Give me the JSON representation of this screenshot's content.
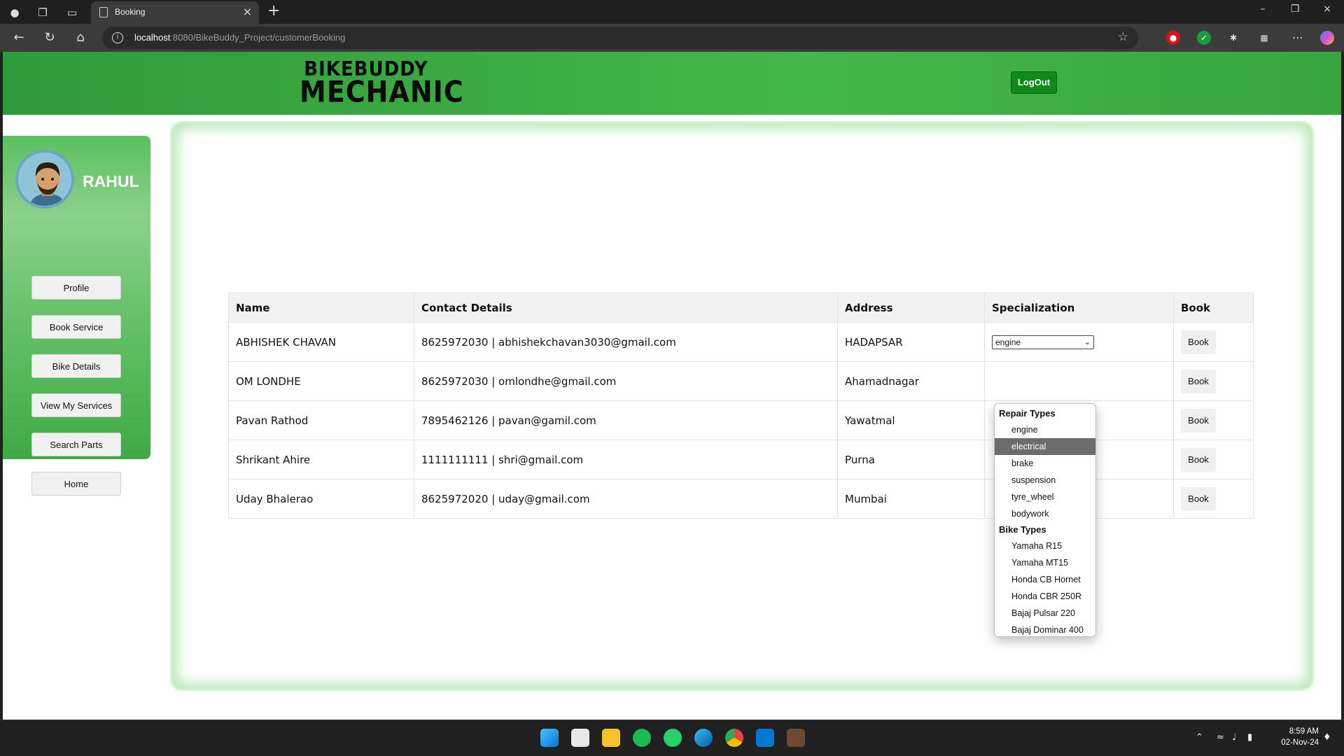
{
  "browser": {
    "tab_title": "Booking",
    "url_host": "localhost",
    "url_rest": ":8080/BikeBuddy_Project/customerBooking"
  },
  "header": {
    "logo_line1": "BIKEBUDDY",
    "logo_line2": "MECHANIC",
    "logout_label": "LogOut"
  },
  "sidebar": {
    "user_name": "RAHUL",
    "items": [
      {
        "label": "Profile"
      },
      {
        "label": "Book Service"
      },
      {
        "label": "Bike Details"
      },
      {
        "label": "View My Services"
      },
      {
        "label": "Search Parts"
      },
      {
        "label": "Home"
      }
    ]
  },
  "table": {
    "headers": [
      "Name",
      "Contact Details",
      "Address",
      "Specialization",
      "Book"
    ],
    "rows": [
      {
        "name": "ABHISHEK CHAVAN",
        "contact": "8625972030 | abhishekchavan3030@gmail.com",
        "address": "HADAPSAR",
        "specialization": "engine",
        "book": "Book"
      },
      {
        "name": "OM LONDHE",
        "contact": "8625972030 | omlondhe@gmail.com",
        "address": "Ahamadnagar",
        "specialization": "",
        "book": "Book"
      },
      {
        "name": "Pavan Rathod",
        "contact": "7895462126 | pavan@gamil.com",
        "address": "Yawatmal",
        "specialization": "",
        "book": "Book"
      },
      {
        "name": "Shrikant Ahire",
        "contact": "1111111111 | shri@gmail.com",
        "address": "Purna",
        "specialization": "",
        "book": "Book"
      },
      {
        "name": "Uday Bhalerao",
        "contact": "8625972020 | uday@gmail.com",
        "address": "Mumbai",
        "specialization": "",
        "book": "Book"
      }
    ]
  },
  "dropdown": {
    "groups": [
      {
        "label": "Repair Types",
        "options": [
          "engine",
          "electrical",
          "brake",
          "suspension",
          "tyre_wheel",
          "bodywork"
        ]
      },
      {
        "label": "Bike Types",
        "options": [
          "Yamaha R15",
          "Yamaha MT15",
          "Honda CB Hornet",
          "Honda CBR 250R",
          "Bajaj Pulsar 220",
          "Bajaj Dominar 400"
        ]
      }
    ],
    "highlighted": "electrical"
  },
  "taskbar": {
    "time": "8:59 AM",
    "date": "02-Nov-24"
  },
  "colors": {
    "header_green": "#45b649",
    "logout_green": "#0f8a1a",
    "highlight_gray": "#6c6c6c"
  }
}
